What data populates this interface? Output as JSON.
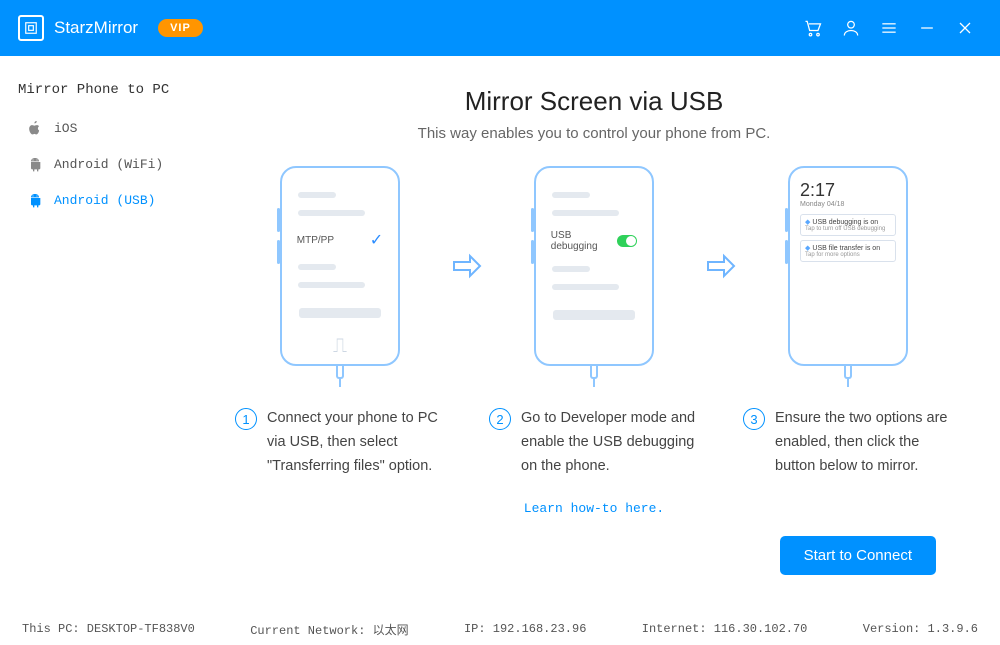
{
  "brand": "StarzMirror",
  "vip": "VIP",
  "sidebar": {
    "title": "Mirror Phone to PC",
    "items": [
      {
        "label": "iOS"
      },
      {
        "label": "Android (WiFi)"
      },
      {
        "label": "Android (USB)"
      }
    ]
  },
  "main": {
    "title": "Mirror Screen via USB",
    "subtitle": "This way enables you to control your phone from PC.",
    "phone1_row": "MTP/PP",
    "phone2_row": "USB debugging",
    "phone3": {
      "time": "2:17",
      "date": "Monday 04/18",
      "notif1_title": "USB debugging is on",
      "notif1_sub": "Tap to turn off USB debugging",
      "notif2_title": "USB file transfer is on",
      "notif2_sub": "Tap for more options"
    },
    "steps": [
      {
        "num": "1",
        "desc": "Connect your phone to PC via USB, then select \"Transferring files\" option."
      },
      {
        "num": "2",
        "desc": "Go to Developer mode and enable the USB debugging on the phone."
      },
      {
        "num": "3",
        "desc": "Ensure the two options are enabled, then click the button below to mirror."
      }
    ],
    "learn": "Learn how-to here.",
    "connect": "Start to Connect"
  },
  "status": {
    "pc": "This PC: DESKTOP-TF838V0",
    "network": "Current Network: 以太网",
    "ip": "IP: 192.168.23.96",
    "internet": "Internet: 116.30.102.70",
    "version": "Version: 1.3.9.6"
  }
}
